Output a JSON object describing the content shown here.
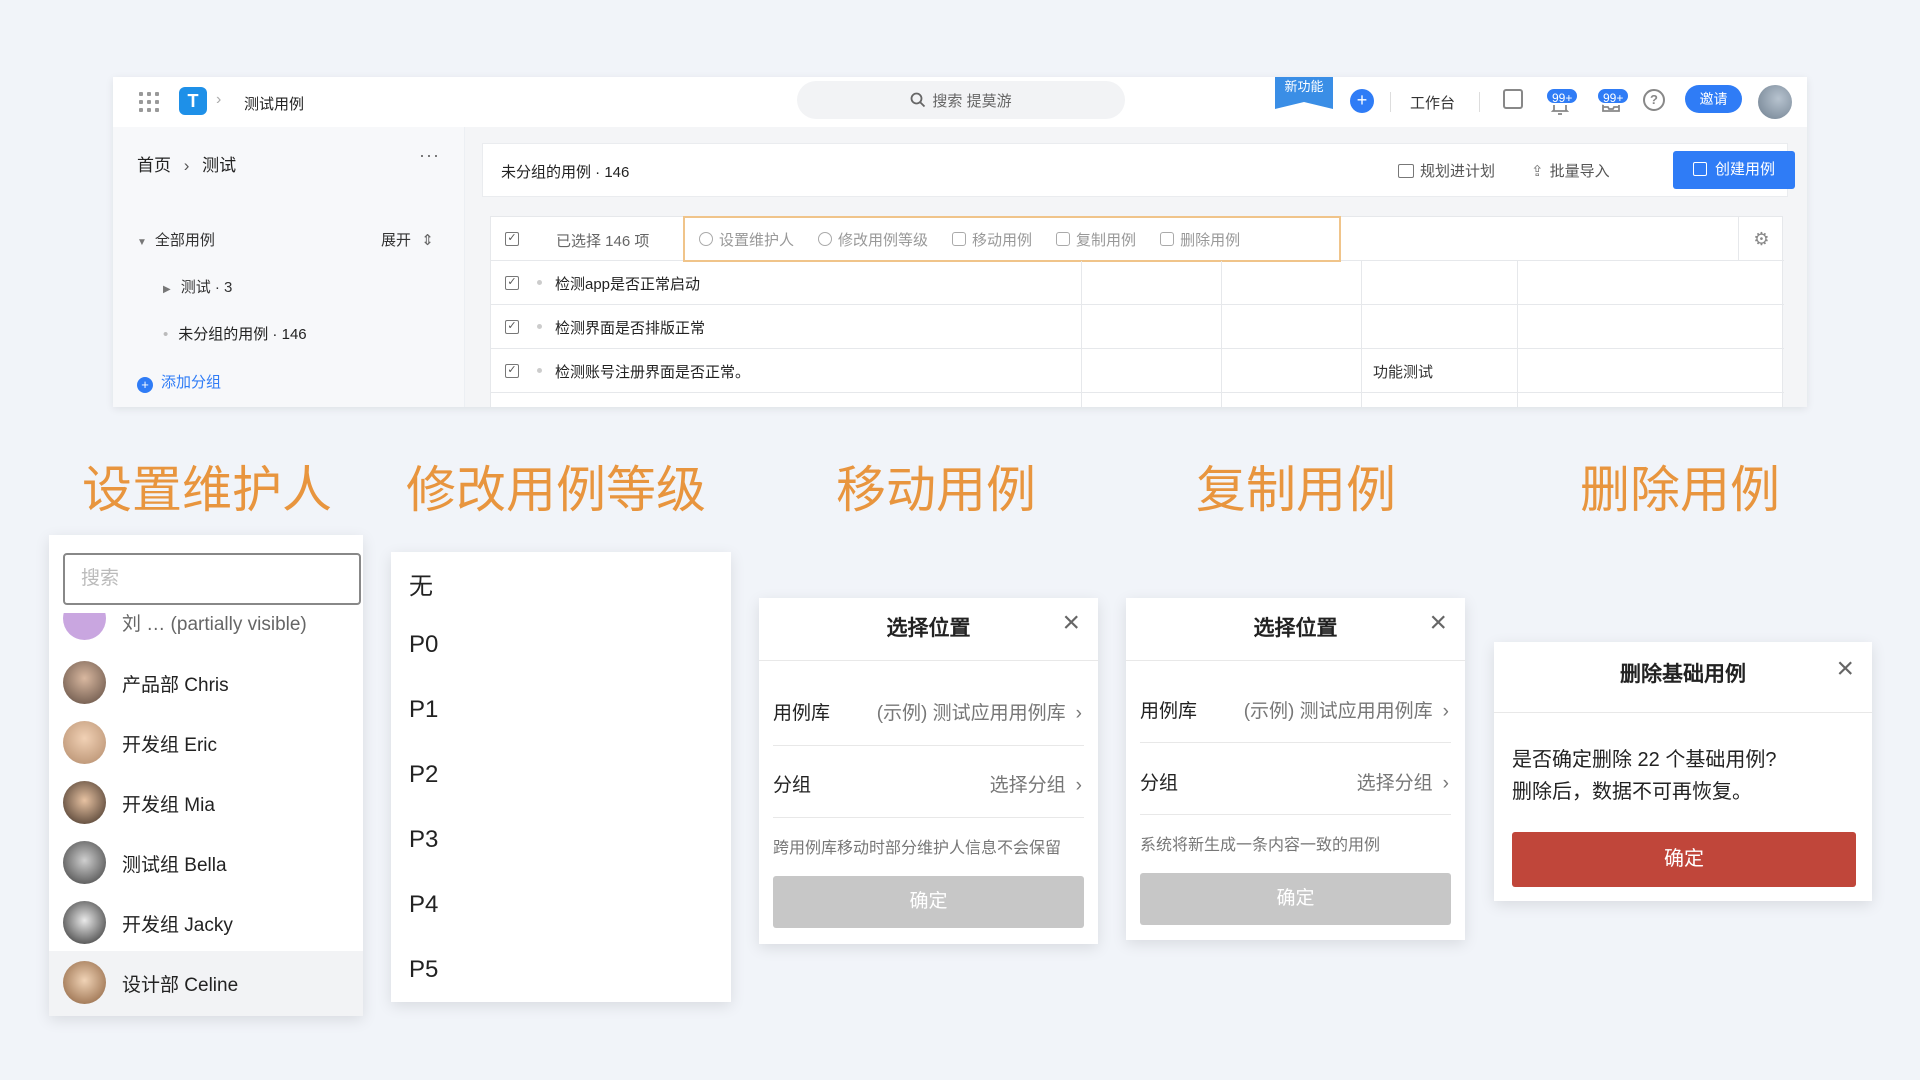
{
  "app": {
    "title": "测试用例",
    "search_placeholder": "搜索 提莫游",
    "new_feature": "新功能",
    "workbench": "工作台",
    "notif_badge": "99+",
    "msg_badge": "99+",
    "invite": "邀请"
  },
  "sidebar": {
    "breadcrumb_home": "首页",
    "breadcrumb_current": "测试",
    "more": "···",
    "all_cases": "全部用例",
    "expand": "展开",
    "items": [
      {
        "label": "测试 · 3"
      },
      {
        "label": "未分组的用例 · 146"
      }
    ],
    "add_group": "添加分组"
  },
  "main": {
    "header_title": "未分组的用例 · 146",
    "plan": "规划进计划",
    "import": "批量导入",
    "create": "创建用例",
    "selected_count": "已选择 146 项",
    "actions": [
      {
        "label": "设置维护人"
      },
      {
        "label": "修改用例等级"
      },
      {
        "label": "移动用例"
      },
      {
        "label": "复制用例"
      },
      {
        "label": "删除用例"
      }
    ],
    "rows": [
      {
        "name": "检测app是否正常启动",
        "type": ""
      },
      {
        "name": "检测界面是否排版正常",
        "type": ""
      },
      {
        "name": "检测账号注册界面是否正常。",
        "type": "功能测试"
      }
    ]
  },
  "captions": [
    "设置维护人",
    "修改用例等级",
    "移动用例",
    "复制用例",
    "删除用例"
  ],
  "assignee": {
    "search_placeholder": "搜索",
    "users": [
      {
        "name": "刘 … (partially visible)"
      },
      {
        "name": "产品部 Chris"
      },
      {
        "name": "开发组 Eric"
      },
      {
        "name": "开发组 Mia"
      },
      {
        "name": "测试组 Bella"
      },
      {
        "name": "开发组 Jacky"
      },
      {
        "name": "设计部 Celine"
      }
    ]
  },
  "levels": [
    "无",
    "P0",
    "P1",
    "P2",
    "P3",
    "P4",
    "P5"
  ],
  "move_dialog": {
    "title": "选择位置",
    "lib_label": "用例库",
    "lib_value": "(示例) 测试应用用例库",
    "group_label": "分组",
    "group_value": "选择分组",
    "note": "跨用例库移动时部分维护人信息不会保留",
    "ok": "确定"
  },
  "copy_dialog": {
    "title": "选择位置",
    "lib_label": "用例库",
    "lib_value": "(示例) 测试应用用例库",
    "group_label": "分组",
    "group_value": "选择分组",
    "note": "系统将新生成一条内容一致的用例",
    "ok": "确定"
  },
  "delete_dialog": {
    "title": "删除基础用例",
    "message": "是否确定删除 22 个基础用例?\n删除后，数据不可再恢复。",
    "ok": "确定"
  },
  "colors": {
    "accent": "#2f7cf6",
    "caption": "#e8953e",
    "danger": "#c0463a",
    "highlight_border": "#f0c48a"
  }
}
